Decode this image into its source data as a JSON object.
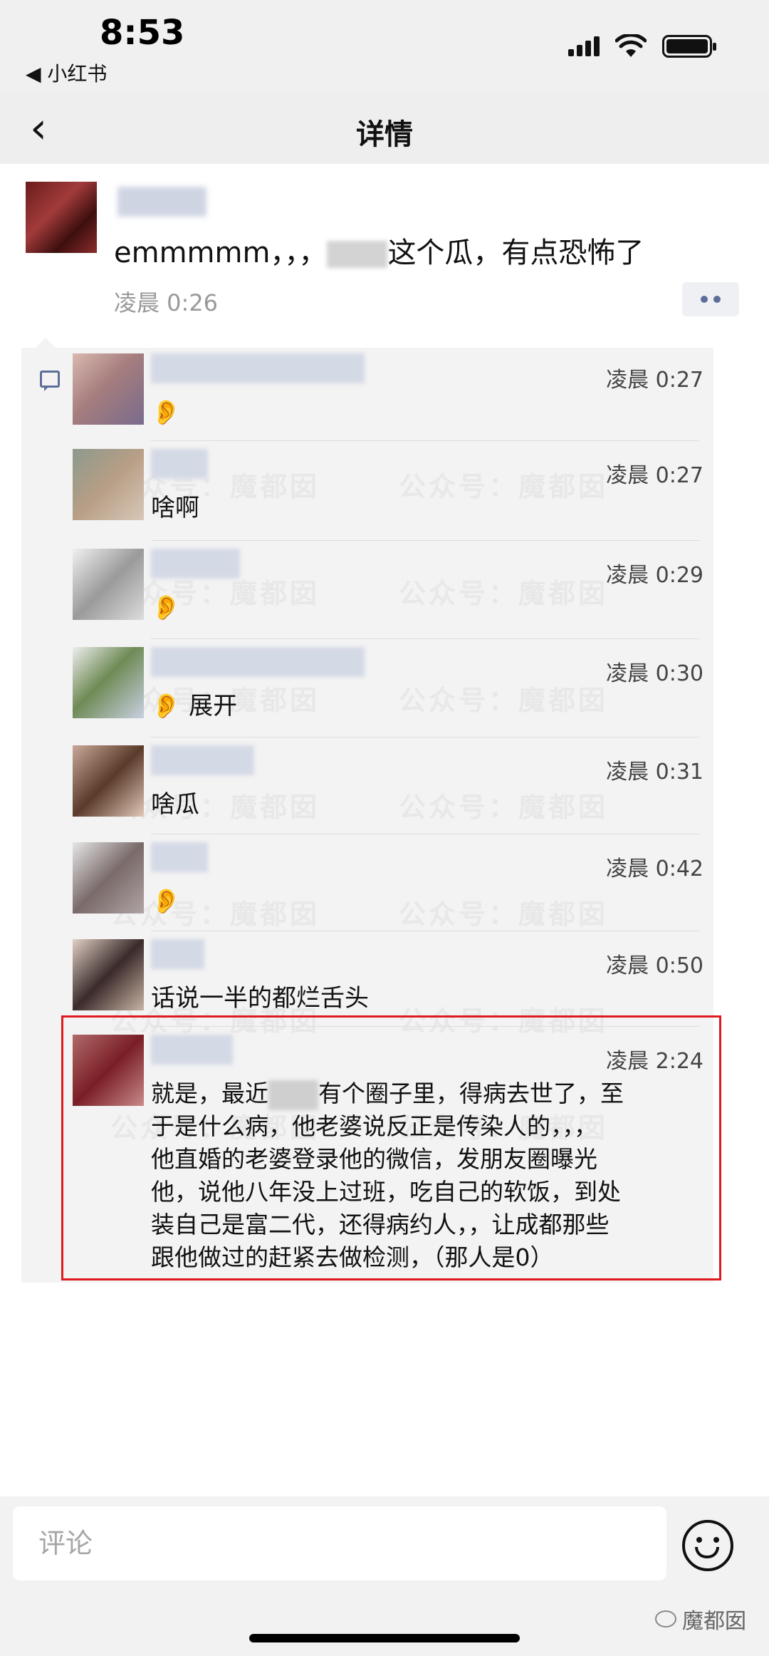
{
  "status_bar": {
    "time": "8:53",
    "back_app": "◀ 小红书"
  },
  "navbar": {
    "back": "‹",
    "title": "详情"
  },
  "post": {
    "text_before": "emmmmm，，，",
    "text_after": "这个瓜，有点恐怖了",
    "time": "凌晨 0:26"
  },
  "comments": [
    {
      "time": "凌晨 0:27",
      "text": "👂"
    },
    {
      "time": "凌晨 0:27",
      "text": "啥啊"
    },
    {
      "time": "凌晨 0:29",
      "text": "👂"
    },
    {
      "time": "凌晨 0:30",
      "text": "👂 展开"
    },
    {
      "time": "凌晨 0:31",
      "text": "啥瓜"
    },
    {
      "time": "凌晨 0:42",
      "text": "👂"
    },
    {
      "time": "凌晨 0:50",
      "text": "话说一半的都烂舌头"
    },
    {
      "time": "凌晨 2:24",
      "line1_a": "就是，最近",
      "line1_b": "有个圈子里，得病去世了，至",
      "line2": "于是什么病，他老婆说反正是传染人的，，，",
      "line3": "他直婚的老婆登录他的微信，发朋友圈曝光",
      "line4": "他，说他八年没上过班，吃自己的软饭，到处",
      "line5": "装自己是富二代，还得病约人，，让成都那些",
      "line6": "跟他做过的赶紧去做检测，（那人是0）"
    }
  ],
  "watermark": "公众号：魔都囡",
  "comment_input": {
    "placeholder": "评论"
  },
  "brand": "魔都囡"
}
